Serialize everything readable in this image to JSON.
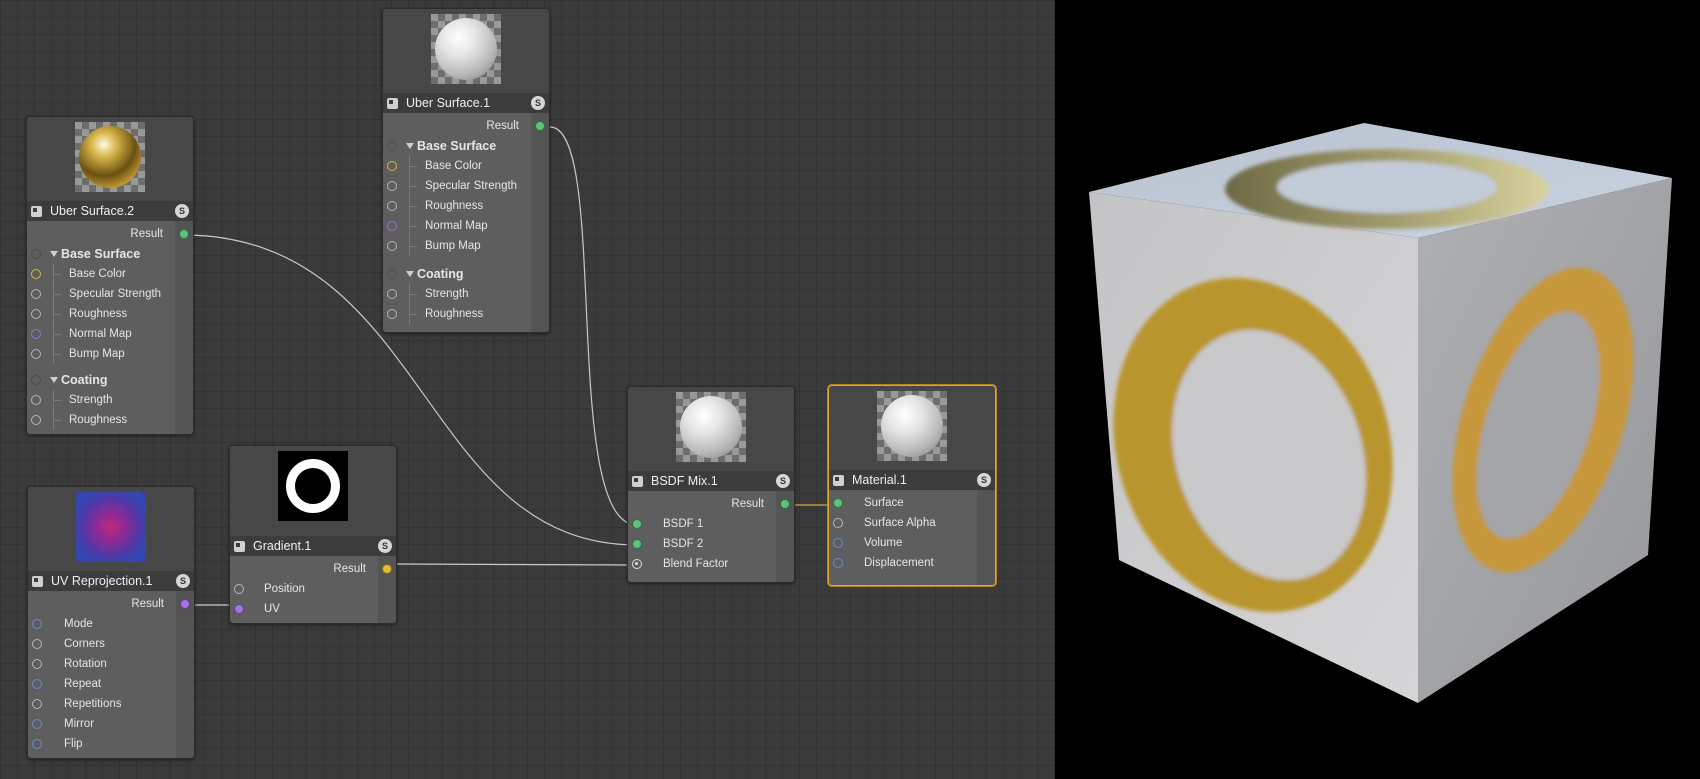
{
  "nodes": {
    "uber1": {
      "title": "Uber Surface.1",
      "badge": "S",
      "output": "Result",
      "groups": [
        {
          "label": "Base Surface",
          "inputs": [
            "Base Color",
            "Specular Strength",
            "Roughness",
            "Normal Map",
            "Bump Map"
          ]
        },
        {
          "label": "Coating",
          "inputs": [
            "Strength",
            "Roughness"
          ]
        }
      ]
    },
    "uber2": {
      "title": "Uber Surface.2",
      "badge": "S",
      "output": "Result",
      "groups": [
        {
          "label": "Base Surface",
          "inputs": [
            "Base Color",
            "Specular Strength",
            "Roughness",
            "Normal Map",
            "Bump Map"
          ]
        },
        {
          "label": "Coating",
          "inputs": [
            "Strength",
            "Roughness"
          ]
        }
      ]
    },
    "uvreproj": {
      "title": "UV Reprojection.1",
      "badge": "S",
      "output": "Result",
      "inputs": [
        "Mode",
        "Corners",
        "Rotation",
        "Repeat",
        "Repetitions",
        "Mirror",
        "Flip"
      ]
    },
    "gradient": {
      "title": "Gradient.1",
      "badge": "S",
      "output": "Result",
      "inputs": [
        "Position",
        "UV"
      ]
    },
    "bsdfmix": {
      "title": "BSDF Mix.1",
      "badge": "S",
      "output": "Result",
      "inputs": [
        "BSDF 1",
        "BSDF 2",
        "Blend Factor"
      ]
    },
    "material": {
      "title": "Material.1",
      "badge": "S",
      "inputs": [
        "Surface",
        "Surface Alpha",
        "Volume",
        "Displacement"
      ]
    }
  },
  "port_colors": {
    "surface": "#5ec27a",
    "color": "#e2b93a",
    "float": "#b6b6b6",
    "vector": "#a474e0",
    "integer": "#6f86d6",
    "selection_outline": "#e0a62e"
  },
  "icons": {
    "node_type": "material-node-icon",
    "solo_badge": "s-badge-icon",
    "collapse": "triangle-down-icon"
  }
}
